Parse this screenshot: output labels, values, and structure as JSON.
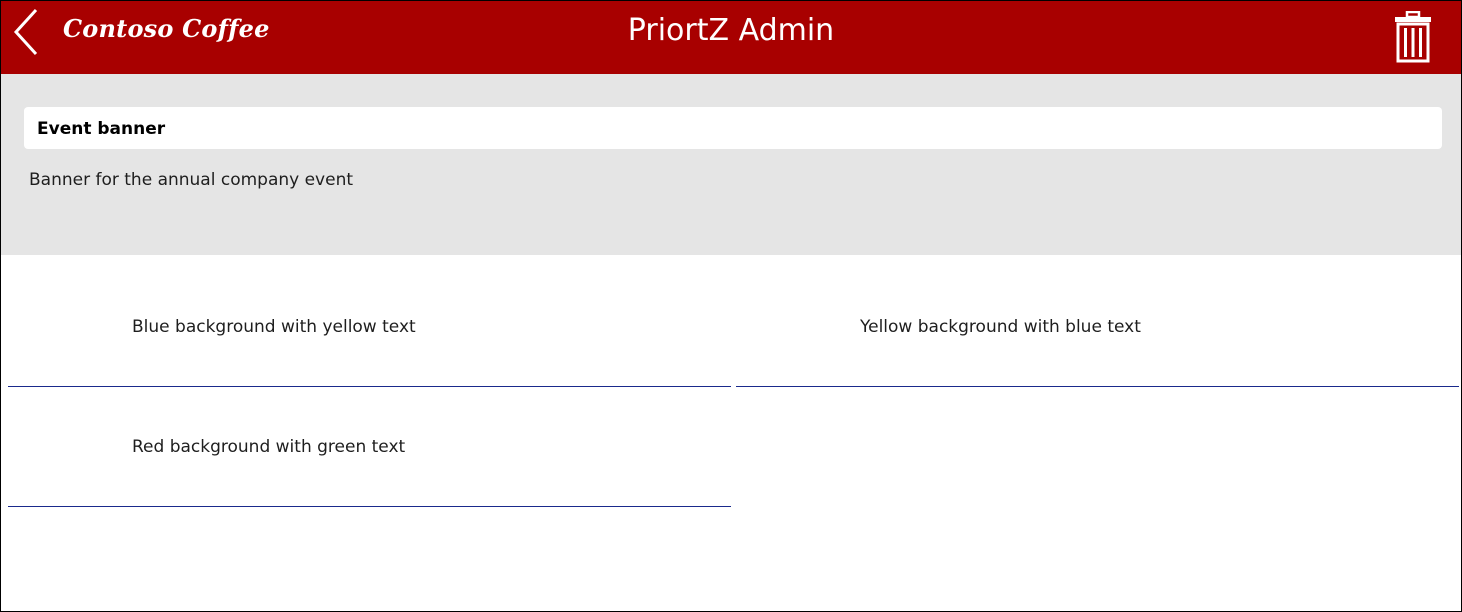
{
  "header": {
    "back_icon": "chevron-left-icon",
    "logo_text": "Contoso Coffee",
    "title": "PriortZ Admin",
    "delete_icon": "trash-icon",
    "background_color": "#a80000"
  },
  "detail": {
    "name": "Event banner",
    "description": "Banner for the annual company event",
    "background_color": "#e5e5e5"
  },
  "gallery": {
    "items": [
      {
        "label": "Blue background with yellow text"
      },
      {
        "label": "Yellow background with blue text"
      },
      {
        "label": "Red background with green text"
      }
    ],
    "divider_color": "#1a2a8c"
  }
}
